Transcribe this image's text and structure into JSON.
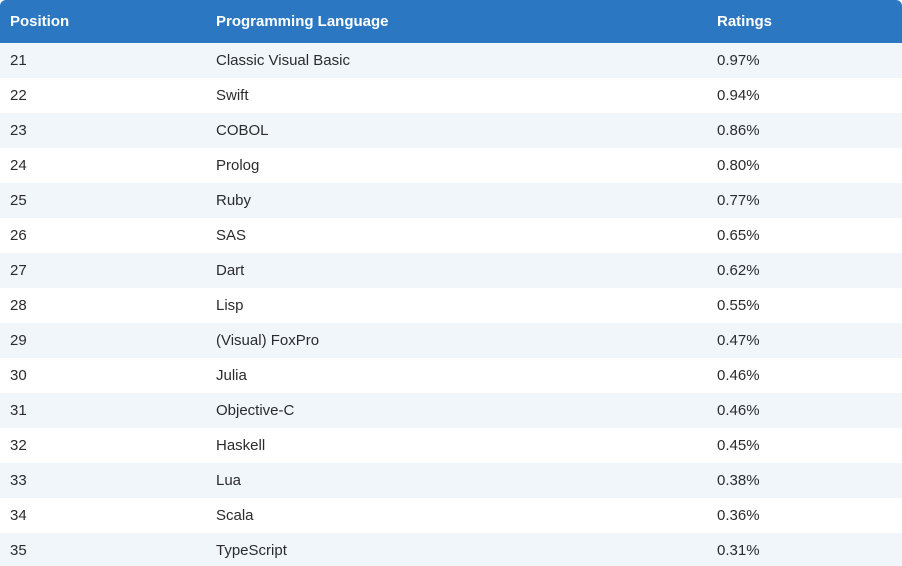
{
  "table": {
    "headers": [
      "Position",
      "Programming Language",
      "Ratings"
    ],
    "rows": [
      [
        "21",
        "Classic Visual Basic",
        "0.97%"
      ],
      [
        "22",
        "Swift",
        "0.94%"
      ],
      [
        "23",
        "COBOL",
        "0.86%"
      ],
      [
        "24",
        "Prolog",
        "0.80%"
      ],
      [
        "25",
        "Ruby",
        "0.77%"
      ],
      [
        "26",
        "SAS",
        "0.65%"
      ],
      [
        "27",
        "Dart",
        "0.62%"
      ],
      [
        "28",
        "Lisp",
        "0.55%"
      ],
      [
        "29",
        "(Visual) FoxPro",
        "0.47%"
      ],
      [
        "30",
        "Julia",
        "0.46%"
      ],
      [
        "31",
        "Objective-C",
        "0.46%"
      ],
      [
        "32",
        "Haskell",
        "0.45%"
      ],
      [
        "33",
        "Lua",
        "0.38%"
      ],
      [
        "34",
        "Scala",
        "0.36%"
      ],
      [
        "35",
        "TypeScript",
        "0.31%"
      ]
    ]
  },
  "colors": {
    "header_bg": "#2b77c2",
    "header_text": "#ffffff",
    "row_alt": "#f1f6fb",
    "row": "#ffffff",
    "text": "#2b2b2b"
  }
}
